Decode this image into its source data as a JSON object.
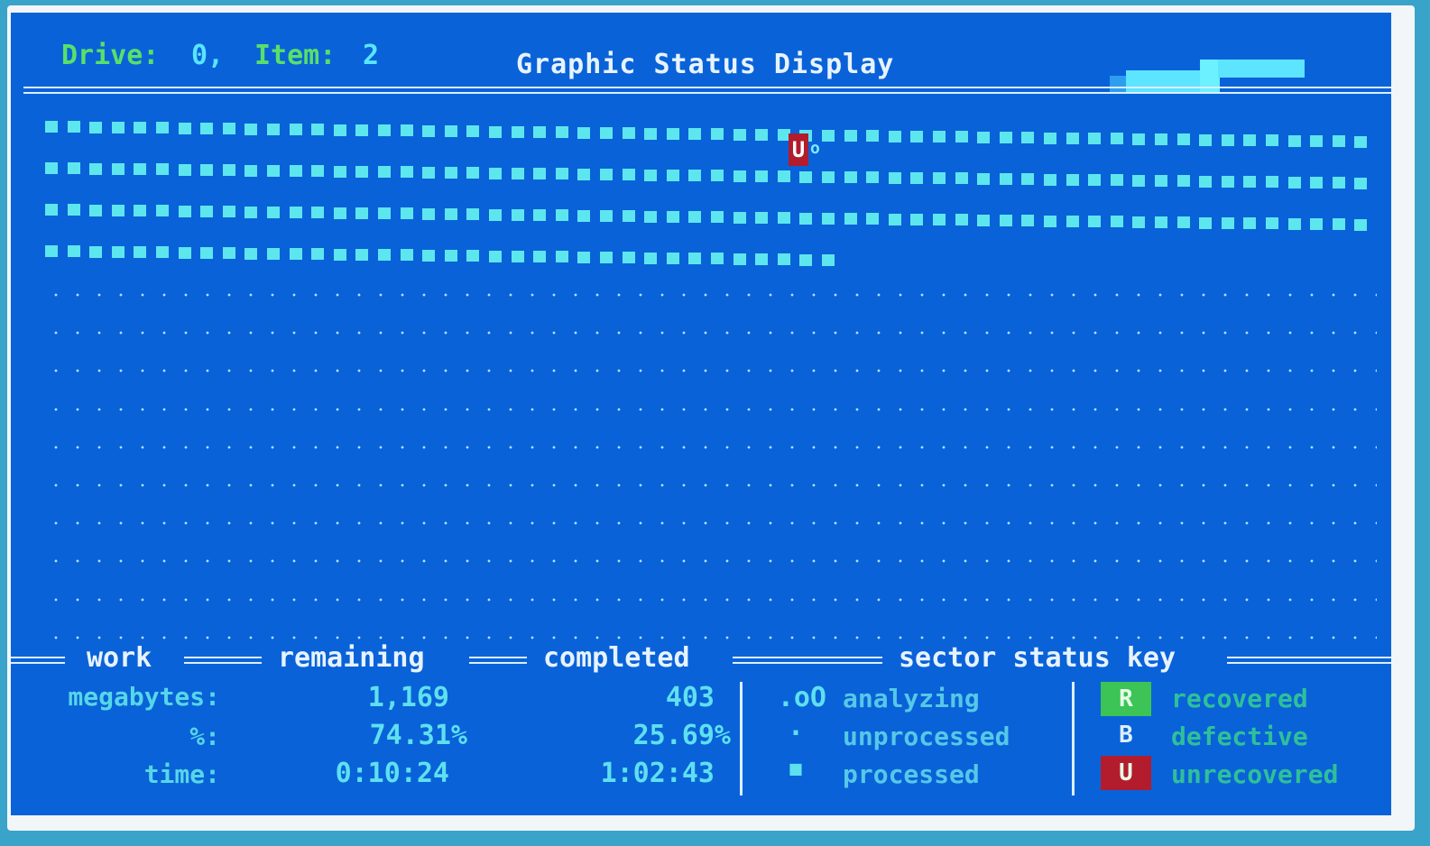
{
  "header": {
    "drive_label": "Drive:",
    "drive_value": "0,",
    "item_label": "Item:",
    "item_value": "2",
    "title": "Graphic Status Display"
  },
  "grid": {
    "full_rows": 3,
    "partial_row_processed_cells": 36,
    "unrecovered_marker": "U",
    "analyzing_marker": "o",
    "empty_rows": 10
  },
  "footer": {
    "headers": {
      "work": "work",
      "remaining": "remaining",
      "completed": "completed",
      "sector_status_key": "sector status key"
    },
    "rows": [
      {
        "label": "megabytes:",
        "remaining": "1,169",
        "completed": "403"
      },
      {
        "label": "%:",
        "remaining": "74.31%",
        "completed": "25.69%"
      },
      {
        "label": "time:",
        "remaining": "0:10:24",
        "completed": "1:02:43"
      }
    ],
    "key": {
      "analyzing_symbol": ".oO",
      "analyzing": "analyzing",
      "unprocessed_symbol": "·",
      "unprocessed": "unprocessed",
      "processed_symbol": "■",
      "processed": "processed",
      "recovered_symbol": "R",
      "recovered": "recovered",
      "defective_symbol": "B",
      "defective": "defective",
      "unrecovered_symbol": "U",
      "unrecovered": "unrecovered"
    }
  },
  "colors": {
    "screen_bg": "#0a62d8",
    "processed": "#5ee6ef",
    "recovered_bg": "#3cc456",
    "unrecovered_bg": "#b31c2c"
  }
}
